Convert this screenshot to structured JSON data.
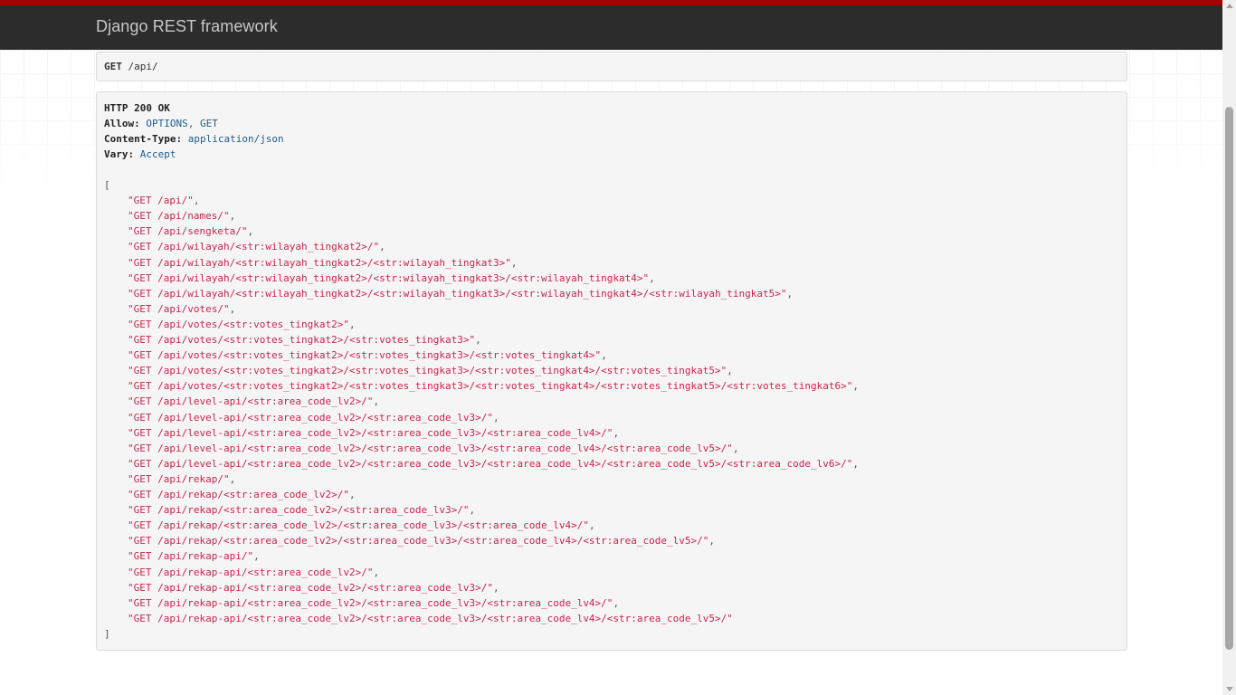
{
  "navbar": {
    "brand": "Django REST framework"
  },
  "request": {
    "method": "GET",
    "path": "/api/"
  },
  "response": {
    "status_line": "HTTP 200 OK",
    "headers": [
      {
        "name": "Allow:",
        "value_parts": [
          "OPTIONS",
          ", ",
          "GET"
        ]
      },
      {
        "name": "Content-Type:",
        "value_parts": [
          "application/json"
        ]
      },
      {
        "name": "Vary:",
        "value_parts": [
          "Accept"
        ]
      }
    ],
    "open_bracket": "[",
    "close_bracket": "]",
    "items": [
      "\"GET /api/\"",
      "\"GET /api/names/\"",
      "\"GET /api/sengketa/\"",
      "\"GET /api/wilayah/<str:wilayah_tingkat2>/\"",
      "\"GET /api/wilayah/<str:wilayah_tingkat2>/<str:wilayah_tingkat3>\"",
      "\"GET /api/wilayah/<str:wilayah_tingkat2>/<str:wilayah_tingkat3>/<str:wilayah_tingkat4>\"",
      "\"GET /api/wilayah/<str:wilayah_tingkat2>/<str:wilayah_tingkat3>/<str:wilayah_tingkat4>/<str:wilayah_tingkat5>\"",
      "\"GET /api/votes/\"",
      "\"GET /api/votes/<str:votes_tingkat2>\"",
      "\"GET /api/votes/<str:votes_tingkat2>/<str:votes_tingkat3>\"",
      "\"GET /api/votes/<str:votes_tingkat2>/<str:votes_tingkat3>/<str:votes_tingkat4>\"",
      "\"GET /api/votes/<str:votes_tingkat2>/<str:votes_tingkat3>/<str:votes_tingkat4>/<str:votes_tingkat5>\"",
      "\"GET /api/votes/<str:votes_tingkat2>/<str:votes_tingkat3>/<str:votes_tingkat4>/<str:votes_tingkat5>/<str:votes_tingkat6>\"",
      "\"GET /api/level-api/<str:area_code_lv2>/\"",
      "\"GET /api/level-api/<str:area_code_lv2>/<str:area_code_lv3>/\"",
      "\"GET /api/level-api/<str:area_code_lv2>/<str:area_code_lv3>/<str:area_code_lv4>/\"",
      "\"GET /api/level-api/<str:area_code_lv2>/<str:area_code_lv3>/<str:area_code_lv4>/<str:area_code_lv5>/\"",
      "\"GET /api/level-api/<str:area_code_lv2>/<str:area_code_lv3>/<str:area_code_lv4>/<str:area_code_lv5>/<str:area_code_lv6>/\"",
      "\"GET /api/rekap/\"",
      "\"GET /api/rekap/<str:area_code_lv2>/\"",
      "\"GET /api/rekap/<str:area_code_lv2>/<str:area_code_lv3>/\"",
      "\"GET /api/rekap/<str:area_code_lv2>/<str:area_code_lv3>/<str:area_code_lv4>/\"",
      "\"GET /api/rekap/<str:area_code_lv2>/<str:area_code_lv3>/<str:area_code_lv4>/<str:area_code_lv5>/\"",
      "\"GET /api/rekap-api/\"",
      "\"GET /api/rekap-api/<str:area_code_lv2>/\"",
      "\"GET /api/rekap-api/<str:area_code_lv2>/<str:area_code_lv3>/\"",
      "\"GET /api/rekap-api/<str:area_code_lv2>/<str:area_code_lv3>/<str:area_code_lv4>/\"",
      "\"GET /api/rekap-api/<str:area_code_lv2>/<str:area_code_lv3>/<str:area_code_lv4>/<str:area_code_lv5>/\""
    ],
    "item_separator": ","
  },
  "colors": {
    "accent_bar": "#a30000",
    "navbar_bg": "#2c2c2c",
    "string": "#c7254e",
    "header_value": "#1f5c88"
  }
}
